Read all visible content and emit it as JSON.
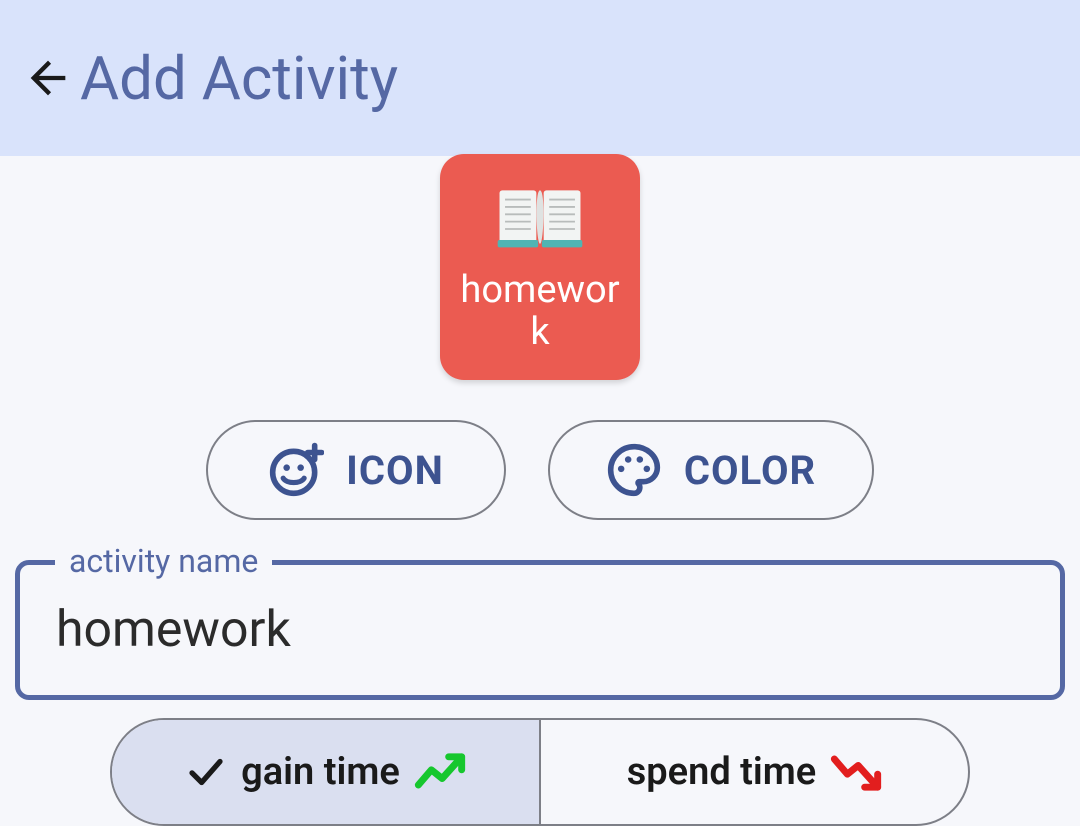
{
  "header": {
    "title": "Add Activity"
  },
  "activityCard": {
    "label": "homework",
    "icon": "open-book-icon",
    "color": "#eb5b51"
  },
  "buttons": {
    "icon_label": "ICON",
    "color_label": "COLOR"
  },
  "field": {
    "label": "activity name",
    "value": "homework"
  },
  "segments": {
    "gain_label": "gain time",
    "spend_label": "spend time",
    "selected": "gain"
  }
}
